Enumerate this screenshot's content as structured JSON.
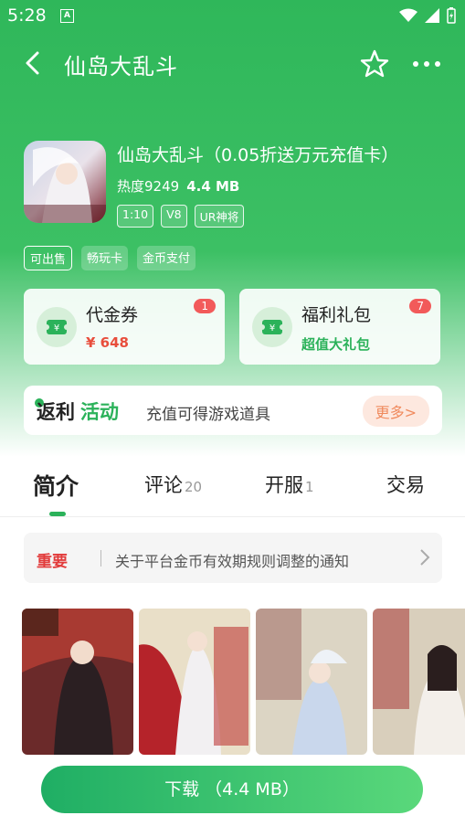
{
  "status_bar": {
    "time": "5:28",
    "indicator": "A"
  },
  "nav": {
    "title": "仙岛大乱斗",
    "icons": [
      "back-arrow-icon",
      "star-icon",
      "more-dots-icon"
    ]
  },
  "game": {
    "name": "仙岛大乱斗（0.05折送万元充值卡）",
    "heat": "热度9249",
    "size": "4.4 MB",
    "meta_tags": [
      "1:10",
      "V8",
      "UR神将"
    ],
    "feature_tags": [
      "可出售",
      "畅玩卡",
      "金币支付"
    ]
  },
  "cards": [
    {
      "title": "代金券",
      "subtitle": "¥ 648",
      "badge": "1",
      "icon": "ticket-icon"
    },
    {
      "title": "福利礼包",
      "subtitle": "超值大礼包",
      "badge": "7",
      "icon": "gift-ticket-icon"
    }
  ],
  "rebate": {
    "label_a": "返利",
    "label_b": "活动",
    "desc": "充值可得游戏道具",
    "more": "更多>"
  },
  "tabs": [
    {
      "label": "简介",
      "count": ""
    },
    {
      "label": "评论",
      "count": "20"
    },
    {
      "label": "开服",
      "count": "1"
    },
    {
      "label": "交易",
      "count": ""
    }
  ],
  "notice": {
    "tag": "重要",
    "text": "关于平台金币有效期规则调整的通知"
  },
  "screenshots": [
    "screenshot-1",
    "screenshot-2",
    "screenshot-3",
    "screenshot-4"
  ],
  "download": {
    "label": "下载 （4.4 MB）"
  },
  "colors": {
    "brand_green": "#2fb75a",
    "accent_red": "#e84e3c",
    "badge_red": "#f25a5a"
  }
}
